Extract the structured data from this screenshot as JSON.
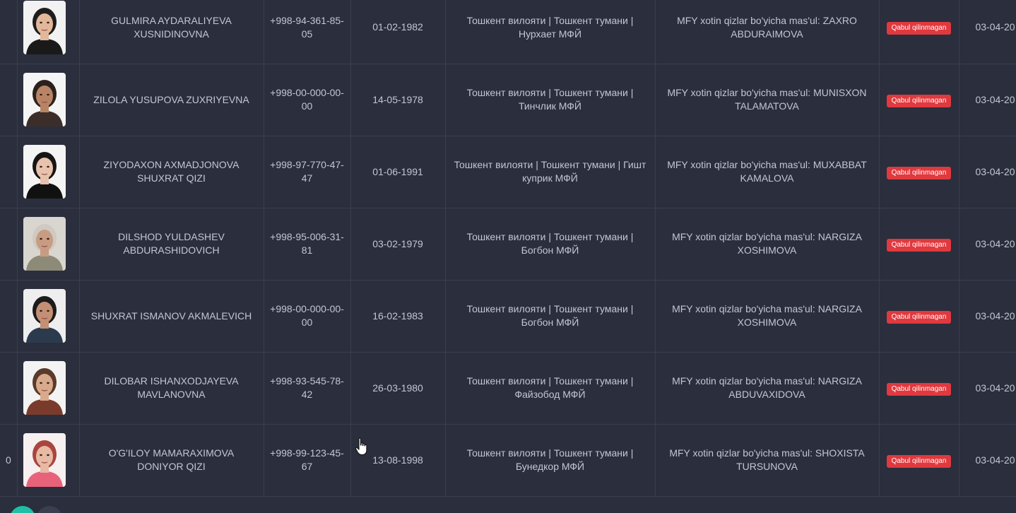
{
  "rows": [
    {
      "index": "",
      "name": "GULMIRA AYDARALIYEVA XUSNIDINOVNA",
      "phone": "+998-94-361-85-05",
      "birth_date": "01-02-1982",
      "address": "Тошкент вилояти | Тошкент тумани | Нурхает МФЙ",
      "responsible": "MFY xotin qizlar bo'yicha mas'ul: ZAXRO ABDURAIMOVA",
      "status": "Qabul qilinmagan",
      "created": "03-04-20",
      "photo": {
        "bg": "#f2f2f2",
        "skin": "#e2b79a",
        "hair": "#1f1c1d",
        "shirt": "#1a1a1a"
      }
    },
    {
      "index": "",
      "name": "ZILOLA YUSUPOVA ZUXRIYEVNA",
      "phone": "+998-00-000-00-00",
      "birth_date": "14-05-1978",
      "address": "Тошкент вилояти | Тошкент тумани | Тинчлик МФЙ",
      "responsible": "MFY xotin qizlar bo'yicha mas'ul: MUNISXON TALAMATOVA",
      "status": "Qabul qilinmagan",
      "created": "03-04-20",
      "photo": {
        "bg": "#f5f5f5",
        "skin": "#b98466",
        "hair": "#2a211d",
        "shirt": "#3b2e2a"
      }
    },
    {
      "index": "",
      "name": "ZIYODAXON AXMADJONOVA SHUXRAT QIZI",
      "phone": "+998-97-770-47-47",
      "birth_date": "01-06-1991",
      "address": "Тошкент вилояти | Тошкент тумани | Гишт куприк МФЙ",
      "responsible": "MFY xotin qizlar bo'yicha mas'ul: MUXABBAT KAMALOVA",
      "status": "Qabul qilinmagan",
      "created": "03-04-20",
      "photo": {
        "bg": "#f4f4f4",
        "skin": "#e8c2ad",
        "hair": "#161414",
        "shirt": "#111111"
      }
    },
    {
      "index": "",
      "name": "DILSHOD YULDASHEV ABDURASHIDOVICH",
      "phone": "+998-95-006-31-81",
      "birth_date": "03-02-1979",
      "address": "Тошкент вилояти | Тошкент тумани | Богбон МФЙ",
      "responsible": "MFY xotin qizlar bo'yicha mas'ul: NARGIZA XOSHIMOVA",
      "status": "Qabul qilinmagan",
      "created": "03-04-20",
      "photo": {
        "bg": "#d9d6cf",
        "skin": "#c79c83",
        "hair": "#cfc9c2",
        "shirt": "#8e8a78"
      }
    },
    {
      "index": "",
      "name": "SHUXRAT ISMANOV AKMALEVICH",
      "phone": "+998-00-000-00-00",
      "birth_date": "16-02-1983",
      "address": "Тошкент вилояти | Тошкент тумани | Богбон МФЙ",
      "responsible": "MFY xotin qizlar bo'yicha mas'ul: NARGIZA XOSHIMOVA",
      "status": "Qabul qilinmagan",
      "created": "03-04-20",
      "photo": {
        "bg": "#eeeeee",
        "skin": "#c39075",
        "hair": "#1c1a1a",
        "shirt": "#2c3a4e"
      }
    },
    {
      "index": "",
      "name": "DILOBAR ISHANXODJAYEVA MAVLANOVNA",
      "phone": "+998-93-545-78-42",
      "birth_date": "26-03-1980",
      "address": "Тошкент вилояти | Тошкент тумани | Файзобод МФЙ",
      "responsible": "MFY xotin qizlar bo'yicha mas'ul: NARGIZA ABDUVAXIDOVA",
      "status": "Qabul qilinmagan",
      "created": "03-04-20",
      "photo": {
        "bg": "#f3f3f3",
        "skin": "#d8a98a",
        "hair": "#5a3a2a",
        "shirt": "#7a3b2c"
      }
    },
    {
      "index": "0",
      "name": "O'G'ILOY MAMARAXIMOVA DONIYOR QIZI",
      "phone": "+998-99-123-45-67",
      "birth_date": "13-08-1998",
      "address": "Тошкент вилояти | Тошкент тумани | Бунедкор МФЙ",
      "responsible": "MFY xotin qizlar bo'yicha mas'ul: SHOXISTA TURSUNOVA",
      "status": "Qabul qilinmagan",
      "created": "03-04-20",
      "photo": {
        "bg": "#f6f0f0",
        "skin": "#e8b9a3",
        "hair": "#a9443f",
        "shirt": "#e8637a"
      }
    }
  ],
  "colors": {
    "background": "#2b2e3d",
    "border": "#3a3e50",
    "text": "#c3c6d3",
    "status_badge": "#e0393e",
    "pagination_active": "#1fbfa6"
  },
  "icons": {
    "cursor": "hand-pointer-icon",
    "photo": "person-photo-icon"
  }
}
